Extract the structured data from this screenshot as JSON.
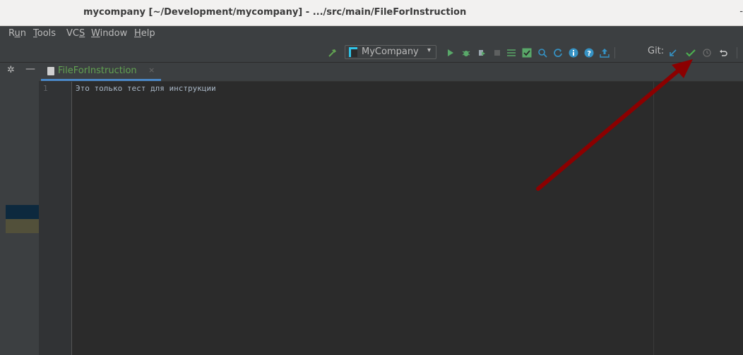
{
  "window": {
    "title": "mycompany [~/Development/mycompany] - .../src/main/FileForInstruction",
    "minimize": "-"
  },
  "menu": {
    "items": [
      {
        "label": "Run",
        "mnemonic_index": 1
      },
      {
        "label": "Tools",
        "mnemonic_index": 0
      },
      {
        "label": "VCS",
        "mnemonic_index": 2
      },
      {
        "label": "Window",
        "mnemonic_index": 0
      },
      {
        "label": "Help",
        "mnemonic_index": 0
      }
    ]
  },
  "toolbar": {
    "build_icon": "hammer-icon",
    "run_config": {
      "label": "MyCompany",
      "caret": "▾"
    },
    "git_label": "Git:",
    "icons": [
      "run-icon",
      "debug-icon",
      "coverage-icon",
      "stop-icon",
      "structure-icon",
      "check-icon",
      "search-icon",
      "refresh-icon",
      "info-icon",
      "help-icon",
      "upload-icon",
      "git-update-icon",
      "git-commit-icon",
      "git-history-icon",
      "git-revert-icon"
    ]
  },
  "tabs": [
    {
      "label": "FileForInstruction",
      "close": "×",
      "active": true
    }
  ],
  "editor": {
    "line_numbers": [
      "1"
    ],
    "lines": [
      "Это только тест для инструкции"
    ]
  },
  "colors": {
    "accent_green": "#62a352",
    "git_check": "#4caf50",
    "arrow": "#8b0000",
    "tab_underline": "#4a88c7"
  }
}
